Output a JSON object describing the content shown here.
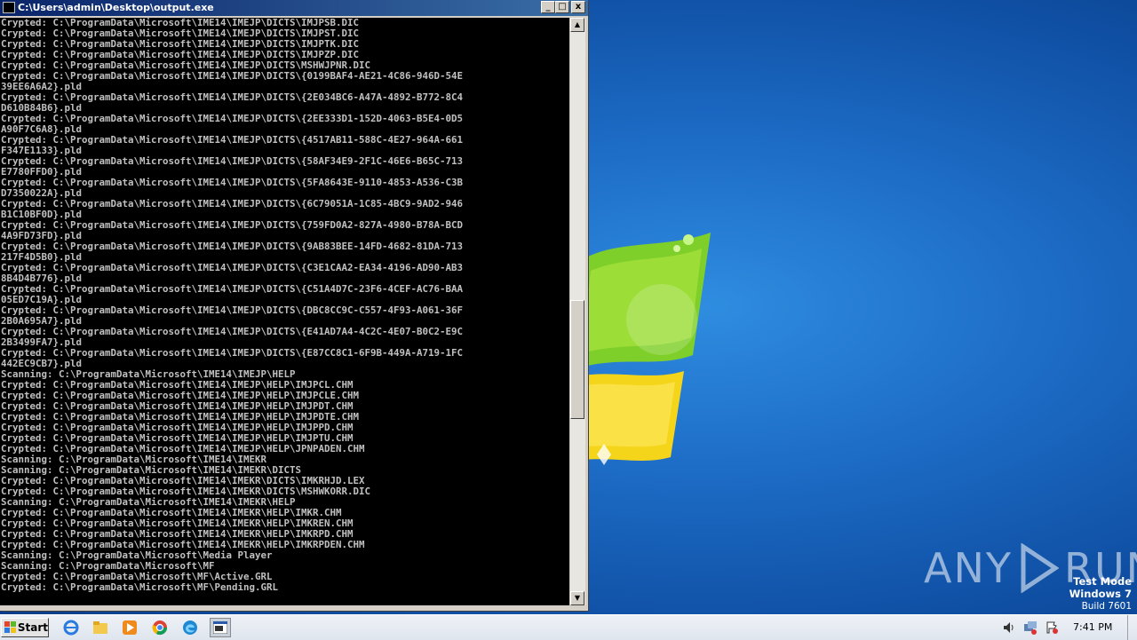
{
  "window": {
    "title": "C:\\Users\\admin\\Desktop\\output.exe",
    "minimize_glyph": "_",
    "maximize_glyph": "□",
    "close_glyph": "x"
  },
  "console_lines": [
    "Crypted: C:\\ProgramData\\Microsoft\\IME14\\IMEJP\\DICTS\\IMJPSB.DIC",
    "Crypted: C:\\ProgramData\\Microsoft\\IME14\\IMEJP\\DICTS\\IMJPST.DIC",
    "Crypted: C:\\ProgramData\\Microsoft\\IME14\\IMEJP\\DICTS\\IMJPTK.DIC",
    "Crypted: C:\\ProgramData\\Microsoft\\IME14\\IMEJP\\DICTS\\IMJPZP.DIC",
    "Crypted: C:\\ProgramData\\Microsoft\\IME14\\IMEJP\\DICTS\\MSHWJPNR.DIC",
    "Crypted: C:\\ProgramData\\Microsoft\\IME14\\IMEJP\\DICTS\\{0199BAF4-AE21-4C86-946D-54E",
    "39EE6A6A2}.pld",
    "Crypted: C:\\ProgramData\\Microsoft\\IME14\\IMEJP\\DICTS\\{2E034BC6-A47A-4892-B772-8C4",
    "D610B84B6}.pld",
    "Crypted: C:\\ProgramData\\Microsoft\\IME14\\IMEJP\\DICTS\\{2EE333D1-152D-4063-B5E4-0D5",
    "A90F7C6A8}.pld",
    "Crypted: C:\\ProgramData\\Microsoft\\IME14\\IMEJP\\DICTS\\{4517AB11-588C-4E27-964A-661",
    "F347E1133}.pld",
    "Crypted: C:\\ProgramData\\Microsoft\\IME14\\IMEJP\\DICTS\\{58AF34E9-2F1C-46E6-B65C-713",
    "E7780FFD0}.pld",
    "Crypted: C:\\ProgramData\\Microsoft\\IME14\\IMEJP\\DICTS\\{5FA8643E-9110-4853-A536-C3B",
    "D7350022A}.pld",
    "Crypted: C:\\ProgramData\\Microsoft\\IME14\\IMEJP\\DICTS\\{6C79051A-1C85-4BC9-9AD2-946",
    "B1C10BF0D}.pld",
    "Crypted: C:\\ProgramData\\Microsoft\\IME14\\IMEJP\\DICTS\\{759FD0A2-827A-4980-B78A-BCD",
    "4A9FD73FD}.pld",
    "Crypted: C:\\ProgramData\\Microsoft\\IME14\\IMEJP\\DICTS\\{9AB83BEE-14FD-4682-81DA-713",
    "217F4D5B0}.pld",
    "Crypted: C:\\ProgramData\\Microsoft\\IME14\\IMEJP\\DICTS\\{C3E1CAA2-EA34-4196-AD90-AB3",
    "8B4D4B776}.pld",
    "Crypted: C:\\ProgramData\\Microsoft\\IME14\\IMEJP\\DICTS\\{C51A4D7C-23F6-4CEF-AC76-BAA",
    "05ED7C19A}.pld",
    "Crypted: C:\\ProgramData\\Microsoft\\IME14\\IMEJP\\DICTS\\{DBC8CC9C-C557-4F93-A061-36F",
    "2B0A695A7}.pld",
    "Crypted: C:\\ProgramData\\Microsoft\\IME14\\IMEJP\\DICTS\\{E41AD7A4-4C2C-4E07-B0C2-E9C",
    "2B3499FA7}.pld",
    "Crypted: C:\\ProgramData\\Microsoft\\IME14\\IMEJP\\DICTS\\{E87CC8C1-6F9B-449A-A719-1FC",
    "442EC9CB7}.pld",
    "Scanning: C:\\ProgramData\\Microsoft\\IME14\\IMEJP\\HELP",
    "Crypted: C:\\ProgramData\\Microsoft\\IME14\\IMEJP\\HELP\\IMJPCL.CHM",
    "Crypted: C:\\ProgramData\\Microsoft\\IME14\\IMEJP\\HELP\\IMJPCLE.CHM",
    "Crypted: C:\\ProgramData\\Microsoft\\IME14\\IMEJP\\HELP\\IMJPDT.CHM",
    "Crypted: C:\\ProgramData\\Microsoft\\IME14\\IMEJP\\HELP\\IMJPDTE.CHM",
    "Crypted: C:\\ProgramData\\Microsoft\\IME14\\IMEJP\\HELP\\IMJPPD.CHM",
    "Crypted: C:\\ProgramData\\Microsoft\\IME14\\IMEJP\\HELP\\IMJPTU.CHM",
    "Crypted: C:\\ProgramData\\Microsoft\\IME14\\IMEJP\\HELP\\JPNPADEN.CHM",
    "Scanning: C:\\ProgramData\\Microsoft\\IME14\\IMEKR",
    "Scanning: C:\\ProgramData\\Microsoft\\IME14\\IMEKR\\DICTS",
    "Crypted: C:\\ProgramData\\Microsoft\\IME14\\IMEKR\\DICTS\\IMKRHJD.LEX",
    "Crypted: C:\\ProgramData\\Microsoft\\IME14\\IMEKR\\DICTS\\MSHWKORR.DIC",
    "Scanning: C:\\ProgramData\\Microsoft\\IME14\\IMEKR\\HELP",
    "Crypted: C:\\ProgramData\\Microsoft\\IME14\\IMEKR\\HELP\\IMKR.CHM",
    "Crypted: C:\\ProgramData\\Microsoft\\IME14\\IMEKR\\HELP\\IMKREN.CHM",
    "Crypted: C:\\ProgramData\\Microsoft\\IME14\\IMEKR\\HELP\\IMKRPD.CHM",
    "Crypted: C:\\ProgramData\\Microsoft\\IME14\\IMEKR\\HELP\\IMKRPDEN.CHM",
    "Scanning: C:\\ProgramData\\Microsoft\\Media Player",
    "Scanning: C:\\ProgramData\\Microsoft\\MF",
    "Crypted: C:\\ProgramData\\Microsoft\\MF\\Active.GRL",
    "Crypted: C:\\ProgramData\\Microsoft\\MF\\Pending.GRL"
  ],
  "scrollbar": {
    "up_glyph": "▲",
    "down_glyph": "▼"
  },
  "desktop": {
    "watermark_left": "ANY",
    "watermark_right": "RUN",
    "test_mode": "Test Mode",
    "os_name": "Windows 7",
    "build": "Build 7601"
  },
  "taskbar": {
    "start_label": "Start",
    "pinned": [
      "ie-icon",
      "explorer-icon",
      "media-player-icon",
      "chrome-icon",
      "edge-icon",
      "console-app-icon"
    ],
    "clock": "7:41 PM"
  },
  "colors": {
    "console_bg": "#000000",
    "console_text": "#c0c0c0",
    "titlebar_start": "#0a246a",
    "titlebar_end": "#3a6ea5",
    "desktop_blue": "#1d6cc6"
  }
}
